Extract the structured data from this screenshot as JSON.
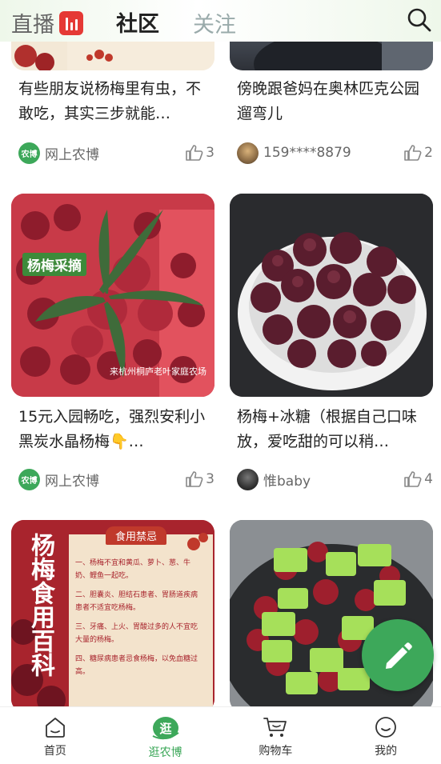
{
  "header": {
    "tabs": {
      "live": "直播",
      "community": "社区",
      "follow": "关注"
    }
  },
  "feed": {
    "cards": [
      {
        "title": "有些朋友说杨梅里有虫，不敢吃，其实三步就能…",
        "author": "网上农博",
        "likes": "3",
        "avatar_text": "农博"
      },
      {
        "title": "傍晚跟爸妈在奥林匹克公园遛弯儿",
        "author": "159****8879",
        "likes": "2"
      },
      {
        "title": "15元入园畅吃，强烈安利小黑炭水晶杨梅👇…",
        "author": "网上农博",
        "likes": "3",
        "avatar_text": "农博",
        "image_caption": "杨梅采摘",
        "image_footer": "来杭州桐庐老叶家庭农场"
      },
      {
        "title": "杨梅+冰糖（根据自己口味放，爱吃甜的可以稍…",
        "author": "惟baby",
        "likes": "4"
      },
      {
        "image_vertical_text": "杨梅食用百科",
        "image_heading": "食用禁忌",
        "image_list": [
          "一、杨梅不宜和黄瓜、萝卜、葱、牛奶、鲤鱼一起吃。",
          "二、胆囊炎、胆结石患者、胃肠道疾病患者不适宜吃杨梅。",
          "三、牙痛、上火、胃酸过多的人不宜吃大量的杨梅。",
          "四、糖尿病患者忌食杨梅，以免血糖过高。"
        ]
      },
      {}
    ]
  },
  "bottom_nav": {
    "items": [
      {
        "label": "首页"
      },
      {
        "label": "逛农博"
      },
      {
        "label": "购物车"
      },
      {
        "label": "我的"
      }
    ]
  },
  "colors": {
    "accent": "#3da85a",
    "live_badge": "#e53935"
  }
}
